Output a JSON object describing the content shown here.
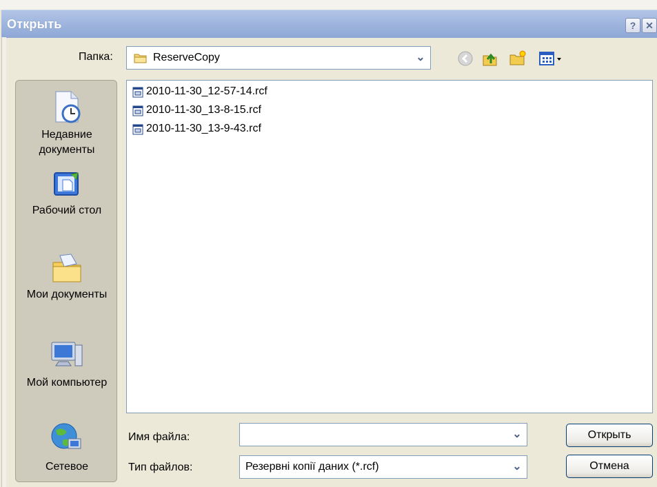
{
  "dialog": {
    "title": "Открыть",
    "help_label": "?",
    "close_label": "✕"
  },
  "folder": {
    "label": "Папка:",
    "value": "ReserveCopy",
    "dropdown_glyph": "⌄"
  },
  "toolbar": {
    "back_icon": "back-icon",
    "up_icon": "folder-up-icon",
    "new_folder_icon": "new-folder-icon",
    "view_menu_icon": "view-menu-icon"
  },
  "places": [
    {
      "label": "Недавние документы",
      "icon": "recent-documents-icon"
    },
    {
      "label": "Рабочий стол",
      "icon": "desktop-icon"
    },
    {
      "label": "Мои документы",
      "icon": "my-documents-icon"
    },
    {
      "label": "Мой компьютер",
      "icon": "my-computer-icon"
    },
    {
      "label": "Сетевое",
      "icon": "network-icon"
    }
  ],
  "files": [
    "2010-11-30_12-57-14.rcf",
    "2010-11-30_13-8-15.rcf",
    "2010-11-30_13-9-43.rcf"
  ],
  "filename": {
    "label": "Имя файла:",
    "value": ""
  },
  "filetype": {
    "label": "Тип файлов:",
    "value": "Резервні копії даних (*.rcf)"
  },
  "buttons": {
    "open": "Открыть",
    "cancel": "Отмена"
  },
  "colors": {
    "titlebar": "#9fb5de",
    "dialog_bg": "#ece9d8",
    "places_bg": "#cfcbbc",
    "field_border": "#7f9db9"
  }
}
